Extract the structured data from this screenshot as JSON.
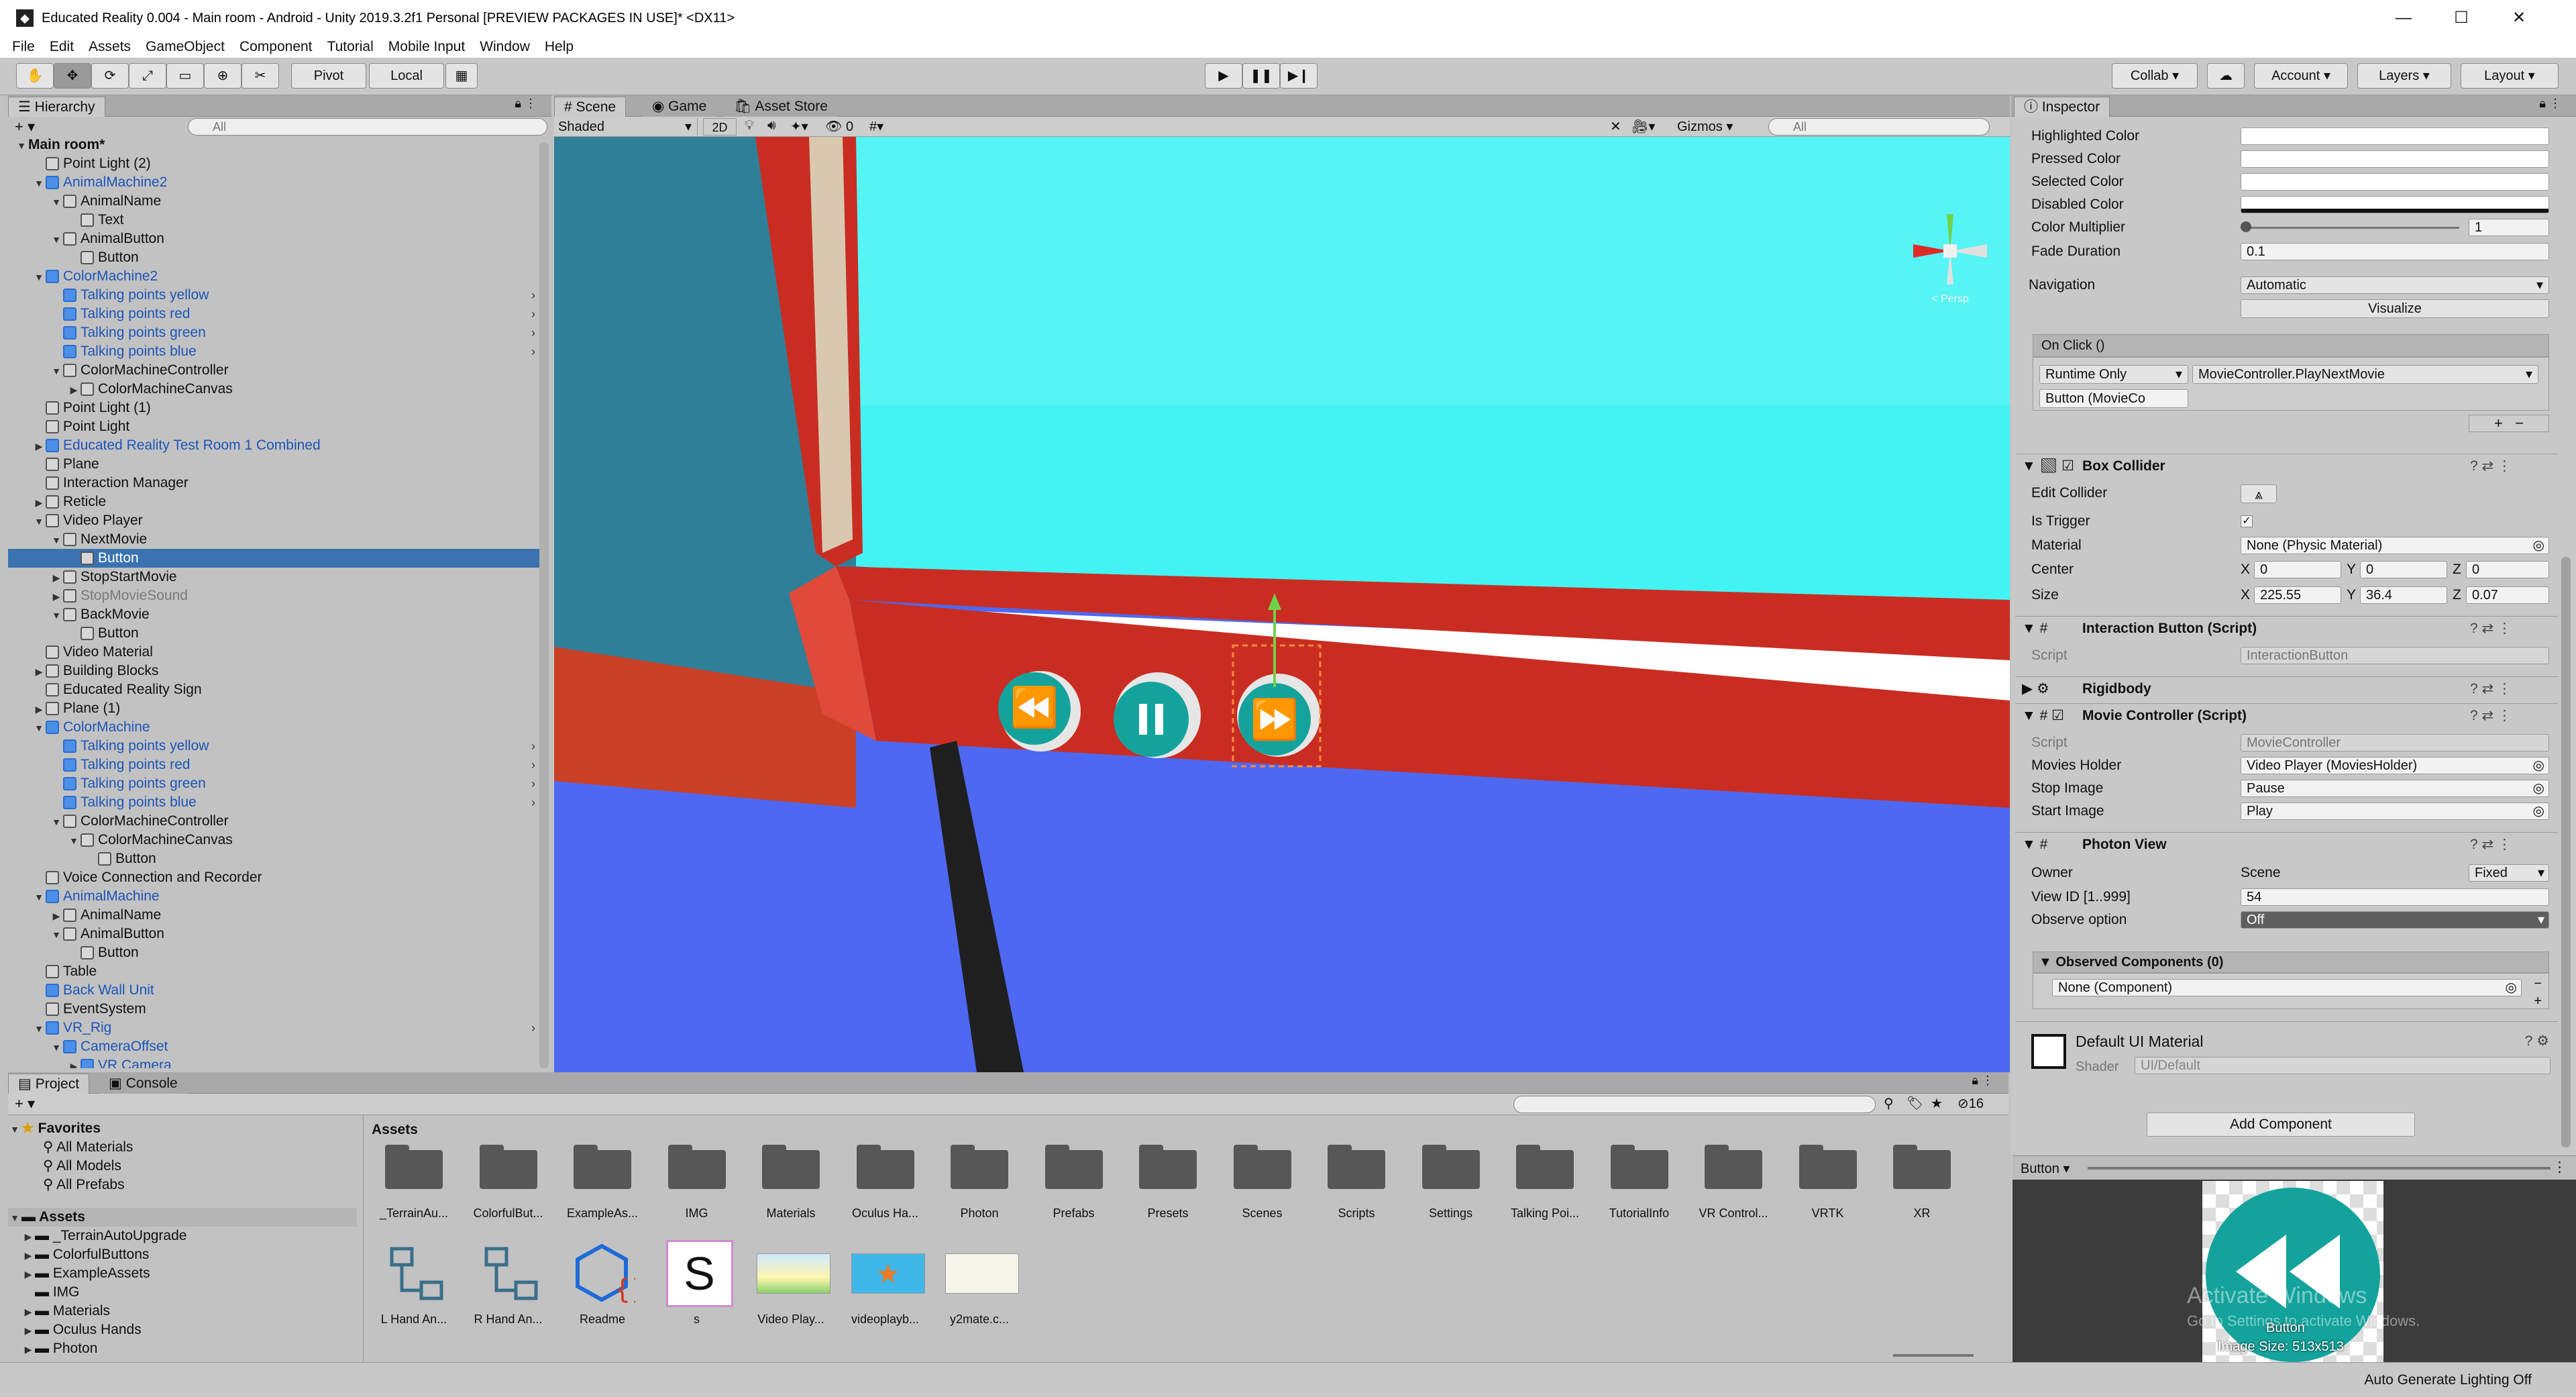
{
  "window": {
    "title": "Educated Reality 0.004 - Main room - Android - Unity 2019.3.2f1 Personal [PREVIEW PACKAGES IN USE]* <DX11>"
  },
  "menu": [
    "File",
    "Edit",
    "Assets",
    "GameObject",
    "Component",
    "Tutorial",
    "Mobile Input",
    "Window",
    "Help"
  ],
  "toolbar": {
    "pivot": "Pivot",
    "local": "Local",
    "collab": "Collab",
    "account": "Account",
    "layers": "Layers",
    "layout": "Layout"
  },
  "hierarchy": {
    "tab": "Hierarchy",
    "search_placeholder": "All",
    "rows": [
      {
        "label": "Main room*",
        "indent": 2,
        "arrow": "▼",
        "kind": "scene"
      },
      {
        "label": "Point Light (2)",
        "indent": 3,
        "arrow": "",
        "kind": "go"
      },
      {
        "label": "AnimalMachine2",
        "indent": 3,
        "arrow": "▼",
        "kind": "prefab"
      },
      {
        "label": "AnimalName",
        "indent": 4,
        "arrow": "▼",
        "kind": "go"
      },
      {
        "label": "Text",
        "indent": 5,
        "arrow": "",
        "kind": "go"
      },
      {
        "label": "AnimalButton",
        "indent": 4,
        "arrow": "▼",
        "kind": "go"
      },
      {
        "label": "Button",
        "indent": 5,
        "arrow": "",
        "kind": "go"
      },
      {
        "label": "ColorMachine2",
        "indent": 3,
        "arrow": "▼",
        "kind": "prefab"
      },
      {
        "label": "Talking points yellow",
        "indent": 4,
        "arrow": "",
        "kind": "prefab",
        "chev": true
      },
      {
        "label": "Talking points red",
        "indent": 4,
        "arrow": "",
        "kind": "prefab",
        "chev": true
      },
      {
        "label": "Talking points green",
        "indent": 4,
        "arrow": "",
        "kind": "prefab",
        "chev": true
      },
      {
        "label": "Talking points blue",
        "indent": 4,
        "arrow": "",
        "kind": "prefab",
        "chev": true
      },
      {
        "label": "ColorMachineController",
        "indent": 4,
        "arrow": "▼",
        "kind": "go"
      },
      {
        "label": "ColorMachineCanvas",
        "indent": 5,
        "arrow": "▶",
        "kind": "go"
      },
      {
        "label": "Point Light (1)",
        "indent": 3,
        "arrow": "",
        "kind": "go"
      },
      {
        "label": "Point Light",
        "indent": 3,
        "arrow": "",
        "kind": "go"
      },
      {
        "label": "Educated Reality Test Room 1 Combined",
        "indent": 3,
        "arrow": "▶",
        "kind": "prefab"
      },
      {
        "label": "Plane",
        "indent": 3,
        "arrow": "",
        "kind": "go"
      },
      {
        "label": "Interaction Manager",
        "indent": 3,
        "arrow": "",
        "kind": "go"
      },
      {
        "label": "Reticle",
        "indent": 3,
        "arrow": "▶",
        "kind": "go"
      },
      {
        "label": "Video Player",
        "indent": 3,
        "arrow": "▼",
        "kind": "go"
      },
      {
        "label": "NextMovie",
        "indent": 4,
        "arrow": "▼",
        "kind": "go"
      },
      {
        "label": "Button",
        "indent": 5,
        "arrow": "",
        "kind": "go",
        "selected": true
      },
      {
        "label": "StopStartMovie",
        "indent": 4,
        "arrow": "▶",
        "kind": "go"
      },
      {
        "label": "StopMovieSound",
        "indent": 4,
        "arrow": "▶",
        "kind": "dim"
      },
      {
        "label": "BackMovie",
        "indent": 4,
        "arrow": "▼",
        "kind": "go"
      },
      {
        "label": "Button",
        "indent": 5,
        "arrow": "",
        "kind": "go"
      },
      {
        "label": "Video Material",
        "indent": 3,
        "arrow": "",
        "kind": "go"
      },
      {
        "label": "Building Blocks",
        "indent": 3,
        "arrow": "▶",
        "kind": "go"
      },
      {
        "label": "Educated Reality Sign",
        "indent": 3,
        "arrow": "",
        "kind": "go"
      },
      {
        "label": "Plane (1)",
        "indent": 3,
        "arrow": "▶",
        "kind": "go"
      },
      {
        "label": "ColorMachine",
        "indent": 3,
        "arrow": "▼",
        "kind": "prefab"
      },
      {
        "label": "Talking points yellow",
        "indent": 4,
        "arrow": "",
        "kind": "prefab",
        "chev": true
      },
      {
        "label": "Talking points red",
        "indent": 4,
        "arrow": "",
        "kind": "prefab",
        "chev": true
      },
      {
        "label": "Talking points green",
        "indent": 4,
        "arrow": "",
        "kind": "prefab",
        "chev": true
      },
      {
        "label": "Talking points blue",
        "indent": 4,
        "arrow": "",
        "kind": "prefab",
        "chev": true
      },
      {
        "label": "ColorMachineController",
        "indent": 4,
        "arrow": "▼",
        "kind": "go"
      },
      {
        "label": "ColorMachineCanvas",
        "indent": 5,
        "arrow": "▼",
        "kind": "go"
      },
      {
        "label": "Button",
        "indent": 6,
        "arrow": "",
        "kind": "go"
      },
      {
        "label": "Voice Connection and Recorder",
        "indent": 3,
        "arrow": "",
        "kind": "go"
      },
      {
        "label": "AnimalMachine",
        "indent": 3,
        "arrow": "▼",
        "kind": "prefab"
      },
      {
        "label": "AnimalName",
        "indent": 4,
        "arrow": "▶",
        "kind": "go"
      },
      {
        "label": "AnimalButton",
        "indent": 4,
        "arrow": "▼",
        "kind": "go"
      },
      {
        "label": "Button",
        "indent": 5,
        "arrow": "",
        "kind": "go"
      },
      {
        "label": "Table",
        "indent": 3,
        "arrow": "",
        "kind": "go"
      },
      {
        "label": "Back Wall Unit",
        "indent": 3,
        "arrow": "",
        "kind": "prefab"
      },
      {
        "label": "EventSystem",
        "indent": 3,
        "arrow": "",
        "kind": "go"
      },
      {
        "label": "VR_Rig",
        "indent": 3,
        "arrow": "▼",
        "kind": "prefab",
        "chev": true
      },
      {
        "label": "CameraOffset",
        "indent": 4,
        "arrow": "▼",
        "kind": "prefab"
      },
      {
        "label": "VR Camera",
        "indent": 5,
        "arrow": "▶",
        "kind": "prefab"
      }
    ]
  },
  "scene": {
    "tabs": [
      "Scene",
      "Game",
      "Asset Store"
    ],
    "shading": "Shaded",
    "mode2d": "2D",
    "gizmos": "Gizmos",
    "search_placeholder": "All",
    "hidden_count": "0",
    "gizmo_label": "< Persp"
  },
  "inspector": {
    "tab": "Inspector",
    "rows_top": [
      {
        "label": "Highlighted Color",
        "type": "color"
      },
      {
        "label": "Pressed Color",
        "type": "color"
      },
      {
        "label": "Selected Color",
        "type": "color"
      },
      {
        "label": "Disabled Color",
        "type": "color"
      }
    ],
    "color_multiplier_label": "Color Multiplier",
    "color_multiplier_value": "1",
    "fade_label": "Fade Duration",
    "fade_value": "0.1",
    "navigation_label": "Navigation",
    "navigation_value": "Automatic",
    "visualize": "Visualize",
    "onclick_header": "On Click ()",
    "runtime": "Runtime Only",
    "function": "MovieController.PlayNextMovie",
    "target": "Button (MovieCo",
    "box_collider": {
      "title": "Box Collider",
      "edit_label": "Edit Collider",
      "trigger_label": "Is Trigger",
      "material_label": "Material",
      "material_value": "None (Physic Material)",
      "center_label": "Center",
      "center": [
        "0",
        "0",
        "0"
      ],
      "size_label": "Size",
      "size": [
        "225.55",
        "36.4",
        "0.07"
      ]
    },
    "interaction_button": {
      "title": "Interaction Button (Script)",
      "script_label": "Script",
      "script_value": "InteractionButton"
    },
    "rigidbody": "Rigidbody",
    "movie_controller": {
      "title": "Movie Controller (Script)",
      "script_label": "Script",
      "script_value": "MovieController",
      "holder_label": "Movies Holder",
      "holder_value": "Video Player (MoviesHolder)",
      "stop_label": "Stop Image",
      "stop_value": "Pause",
      "start_label": "Start Image",
      "start_value": "Play"
    },
    "photon": {
      "title": "Photon View",
      "owner_label": "Owner",
      "owner_value": "Scene",
      "owner_mode": "Fixed",
      "viewid_label": "View ID [1..999]",
      "viewid_value": "54",
      "observe_label": "Observe option",
      "observe_value": "Off",
      "observed_header": "Observed Components (0)",
      "observed_item": "None (Component)"
    },
    "material": {
      "name": "Default UI Material",
      "shader_label": "Shader",
      "shader_value": "UI/Default"
    },
    "add_component": "Add Component",
    "preview_dropdown": "Button",
    "preview_caption": "Button",
    "preview_size": "Image Size: 513x513",
    "watermark_title": "Activate Windows",
    "watermark_sub": "Go to Settings to activate Windows."
  },
  "project": {
    "tabs": [
      "Project",
      "Console"
    ],
    "favorites_label": "Favorites",
    "favorites": [
      "All Materials",
      "All Models",
      "All Prefabs"
    ],
    "assets_label": "Assets",
    "tree": [
      "_TerrainAutoUpgrade",
      "ColorfulButtons",
      "ExampleAssets",
      "IMG",
      "Materials",
      "Oculus Hands",
      "Photon"
    ],
    "breadcrumb": "Assets",
    "hidden_count": "16",
    "folders": [
      "_TerrainAu...",
      "ColorfulBut...",
      "ExampleAs...",
      "IMG",
      "Materials",
      "Oculus Ha...",
      "Photon",
      "Prefabs",
      "Presets",
      "Scenes",
      "Scripts",
      "Settings",
      "Talking Poi...",
      "TutorialInfo",
      "VR Control...",
      "VRTK",
      "XR"
    ],
    "files": [
      "L Hand An...",
      "R Hand An...",
      "Readme",
      "s",
      "Video Play...",
      "videoplayb...",
      "y2mate.c..."
    ]
  },
  "status": {
    "text": "Auto Generate Lighting Off"
  }
}
